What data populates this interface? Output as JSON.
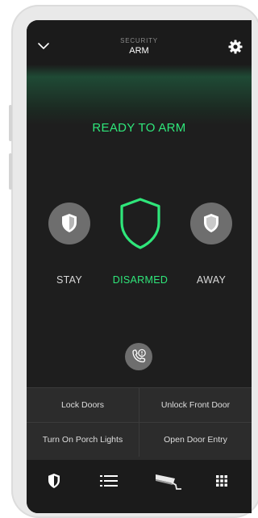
{
  "header": {
    "subtitle": "SECURITY",
    "title": "ARM"
  },
  "status": {
    "text": "READY TO ARM",
    "color": "#2fe67a"
  },
  "modes": [
    {
      "label": "STAY",
      "icon": "shield-icon",
      "active": false
    },
    {
      "label": "DISARMED",
      "icon": "shield-outline-icon",
      "active": true
    },
    {
      "label": "AWAY",
      "icon": "shield-icon",
      "active": false
    }
  ],
  "quick_actions": [
    {
      "label": "Lock Doors"
    },
    {
      "label": "Unlock Front Door"
    },
    {
      "label": "Turn On Porch Lights"
    },
    {
      "label": "Open Door Entry"
    }
  ],
  "pager": {
    "pages": 2,
    "current": 1
  },
  "tabs": [
    {
      "name": "security",
      "icon": "shield-icon",
      "active": true
    },
    {
      "name": "list",
      "icon": "list-icon",
      "active": false
    },
    {
      "name": "cameras",
      "icon": "camera-icon",
      "active": false
    },
    {
      "name": "grid",
      "icon": "grid-icon",
      "active": false
    }
  ],
  "colors": {
    "accent": "#2fe67a",
    "background": "#1e1e1e",
    "panel": "#2c2c2c"
  }
}
